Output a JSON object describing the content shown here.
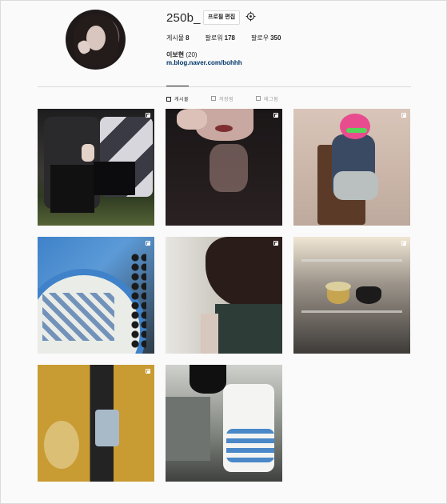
{
  "profile": {
    "username": "250b_",
    "edit_label": "프로필 편집",
    "name": "이보현",
    "age": "(20)",
    "link": "m.blog.naver.com/bohhh",
    "stats": [
      {
        "label": "게시물",
        "value": "8"
      },
      {
        "label": "팔로워",
        "value": "178"
      },
      {
        "label": "팔로우",
        "value": "350"
      }
    ]
  },
  "tabs": [
    {
      "label": "게시물",
      "icon": "grid-icon",
      "active": true
    },
    {
      "label": "저장됨",
      "icon": "bookmark-icon",
      "active": false
    },
    {
      "label": "태그됨",
      "icon": "tag-icon",
      "active": false
    }
  ],
  "posts": [
    {
      "multi": true
    },
    {
      "multi": true
    },
    {
      "multi": true
    },
    {
      "multi": true
    },
    {
      "multi": true
    },
    {
      "multi": true
    },
    {
      "multi": true
    },
    {
      "multi": false
    }
  ],
  "colors": {
    "link": "#003569",
    "text": "#262626",
    "muted": "#999999",
    "border": "#dbdbdb"
  }
}
